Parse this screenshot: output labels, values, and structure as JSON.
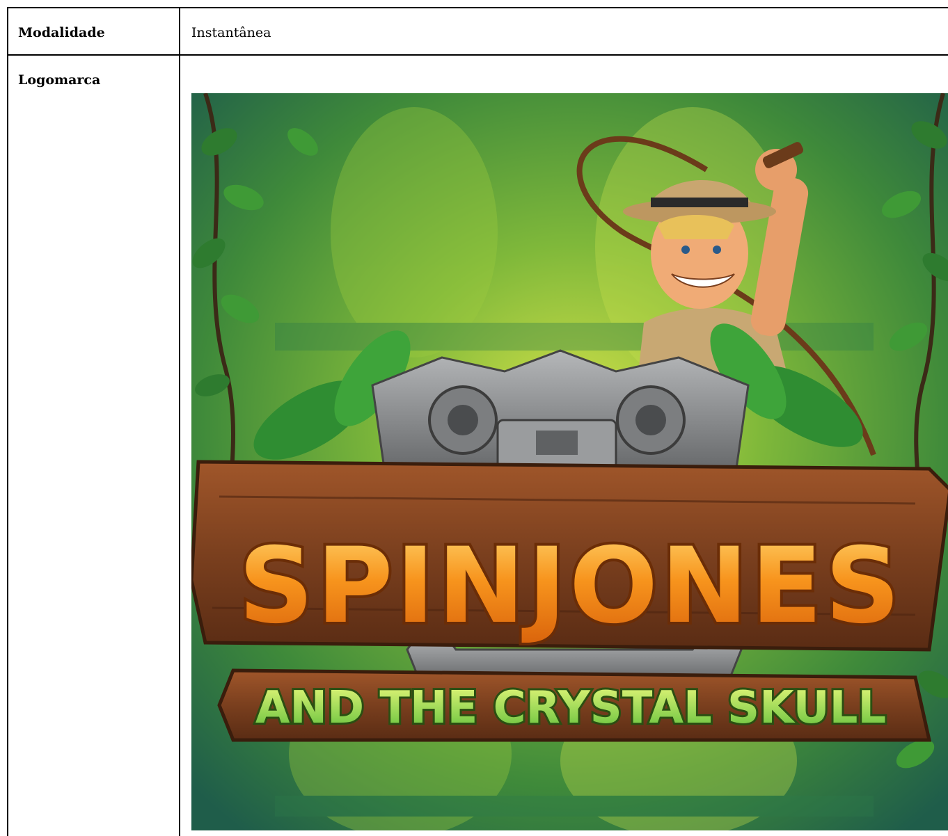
{
  "rows": [
    {
      "label": "Modalidade",
      "value": "Instantânea"
    },
    {
      "label": "Logomarca",
      "value": ""
    }
  ],
  "logo": {
    "title_line1": "SPINJONES",
    "title_line2": "AND THE CRYSTAL SKULL",
    "colors": {
      "jungle_dark": "#2f6b2a",
      "jungle_light": "#b8d641",
      "wood": "#7a3f1e",
      "title_orange": "#f7941d",
      "subtitle_green": "#9bd94a",
      "stone": "#8d8f91"
    }
  }
}
